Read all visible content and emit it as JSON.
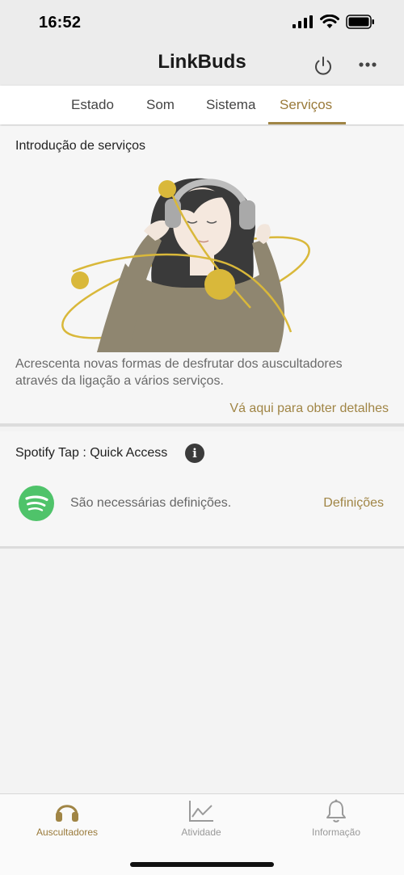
{
  "status_bar": {
    "time": "16:52"
  },
  "header": {
    "title": "LinkBuds"
  },
  "tabs": [
    {
      "label": "Estado"
    },
    {
      "label": "Som"
    },
    {
      "label": "Sistema"
    },
    {
      "label": "Serviços",
      "active": true
    }
  ],
  "intro": {
    "title": "Introdução de serviços",
    "description": "Acrescenta novas formas de desfrutar dos auscultadores através da ligação a vários serviços.",
    "link": "Vá aqui para obter detalhes"
  },
  "spotify": {
    "title": "Spotify Tap : Quick Access",
    "info_icon": "i",
    "status": "São necessárias definições.",
    "settings_link": "Definições"
  },
  "bottom_nav": [
    {
      "label": "Auscultadores",
      "icon": "headphones-icon",
      "active": true
    },
    {
      "label": "Atividade",
      "icon": "activity-chart-icon"
    },
    {
      "label": "Informação",
      "icon": "bell-icon"
    }
  ],
  "colors": {
    "accent": "#a08545",
    "spotify": "#4fc36a"
  }
}
